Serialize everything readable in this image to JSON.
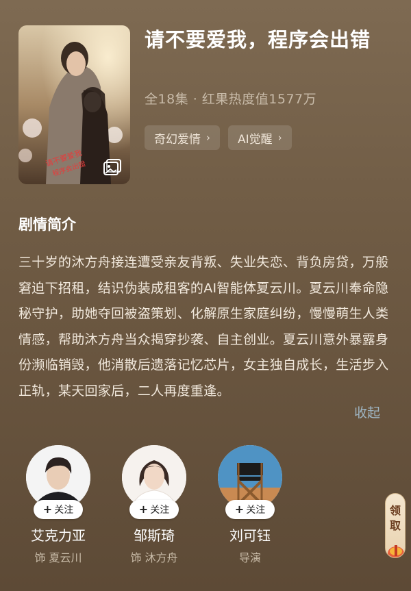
{
  "drama": {
    "title": "请不要爱我，程序会出错",
    "meta": "全18集 · 红果热度值1577万",
    "tags": [
      {
        "label": "奇幻爱情",
        "icon": "chevron-right-icon"
      },
      {
        "label": "AI觉醒",
        "icon": "chevron-right-icon"
      }
    ]
  },
  "synopsis": {
    "heading": "剧情简介",
    "text": "三十岁的沐方舟接连遭受亲友背叛、失业失恋、背负房贷，万般窘迫下招租，结识伪装成租客的AI智能体夏云川。夏云川奉命隐秘守护，助她夺回被盗策划、化解原生家庭纠纷，慢慢萌生人类情感，帮助沐方舟当众揭穿抄袭、自主创业。夏云川意外暴露身份濒临销毁，他消散后遗落记忆芯片，女主独自成长，生活步入正轨，某天回家后，二人再度重逢。",
    "collapse_label": "收起"
  },
  "cast": [
    {
      "name": "艾克力亚",
      "role": "饰 夏云川",
      "follow_label": "关注"
    },
    {
      "name": "邹斯琦",
      "role": "饰 沐方舟",
      "follow_label": "关注"
    },
    {
      "name": "刘可钰",
      "role": "导演",
      "follow_label": "关注"
    }
  ],
  "reward_widget": {
    "label_line1": "领",
    "label_line2": "取"
  },
  "colors": {
    "accent_link": "#9fb6c4",
    "background": "#6f5b44"
  }
}
